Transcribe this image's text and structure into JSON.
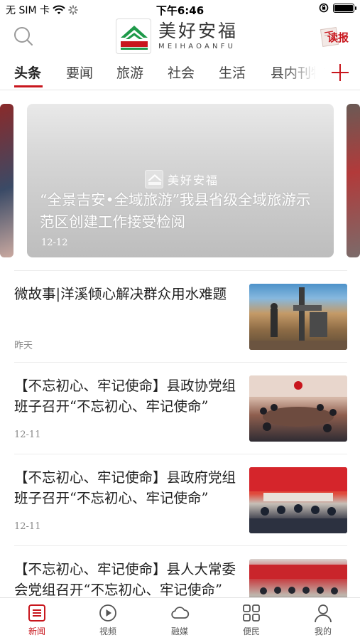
{
  "status_bar": {
    "carrier": "无 SIM 卡",
    "time": "下午6:46"
  },
  "header": {
    "logo_cn": "美好安福",
    "logo_en": "MEIHAOANFU",
    "read_label": "读报"
  },
  "tabs": [
    {
      "label": "头条",
      "active": true
    },
    {
      "label": "要闻",
      "active": false
    },
    {
      "label": "旅游",
      "active": false
    },
    {
      "label": "社会",
      "active": false
    },
    {
      "label": "生活",
      "active": false
    },
    {
      "label": "县内刊物",
      "active": false
    }
  ],
  "carousel": {
    "watermark": "美好安福",
    "title": "“全景吉安•全域旅游”我县省级全域旅游示范区创建工作接受检阅",
    "date": "12-12"
  },
  "news": [
    {
      "title": "微故事|洋溪倾心解决群众用水难题",
      "date": "昨天",
      "thumb": "drilling-rig-photo"
    },
    {
      "title": "【不忘初心、牢记使命】县政协党组班子召开“不忘初心、牢记使命”",
      "date": "12-11",
      "thumb": "meeting-photo"
    },
    {
      "title": "【不忘初心、牢记使命】县政府党组班子召开“不忘初心、牢记使命”",
      "date": "12-11",
      "thumb": "meeting-photo"
    },
    {
      "title": "【不忘初心、牢记使命】县人大常委会党组召开“不忘初心、牢记使命”",
      "date": "",
      "thumb": "meeting-photo"
    }
  ],
  "bottom_nav": [
    {
      "label": "新闻",
      "icon": "news-icon",
      "active": true
    },
    {
      "label": "视频",
      "icon": "play-icon",
      "active": false
    },
    {
      "label": "融媒",
      "icon": "cloud-icon",
      "active": false
    },
    {
      "label": "便民",
      "icon": "grid-icon",
      "active": false
    },
    {
      "label": "我的",
      "icon": "user-icon",
      "active": false
    }
  ],
  "colors": {
    "accent": "#c8161d",
    "logo_green": "#1f9a4a"
  }
}
